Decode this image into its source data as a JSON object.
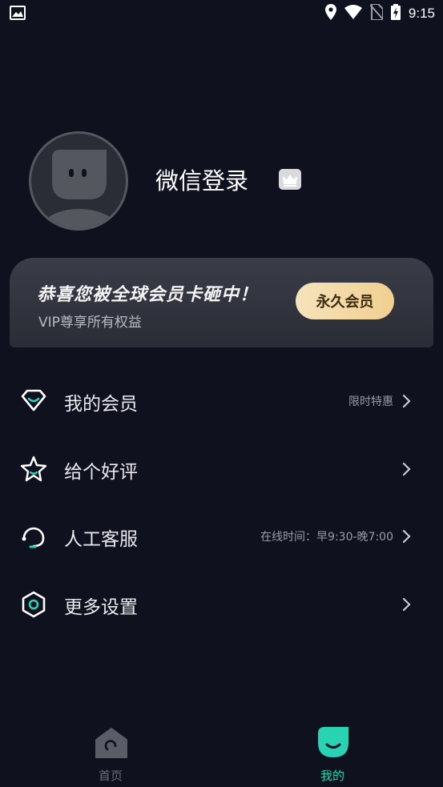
{
  "status_bar": {
    "time": "9:15"
  },
  "profile": {
    "username": "微信登录"
  },
  "vip_banner": {
    "title": "恭喜您被全球会员卡砸中！",
    "subtitle": "VIP尊享所有权益",
    "button_label": "永久会员"
  },
  "menu": [
    {
      "label": "我的会员",
      "extra": "限时特惠",
      "icon": "diamond-icon"
    },
    {
      "label": "给个好评",
      "extra": "",
      "icon": "star-icon"
    },
    {
      "label": "人工客服",
      "extra": "在线时间：早9:30-晚7:00",
      "icon": "headset-icon"
    },
    {
      "label": "更多设置",
      "extra": "",
      "icon": "settings-hexagon-icon"
    }
  ],
  "tabs": [
    {
      "label": "首页",
      "active": false,
      "icon": "home-icon"
    },
    {
      "label": "我的",
      "active": true,
      "icon": "profile-smile-icon"
    }
  ],
  "colors": {
    "accent": "#27d3b2",
    "background": "#10111f",
    "vip_gold": "#f1cf8f",
    "tab_inactive": "#6b6d78"
  }
}
